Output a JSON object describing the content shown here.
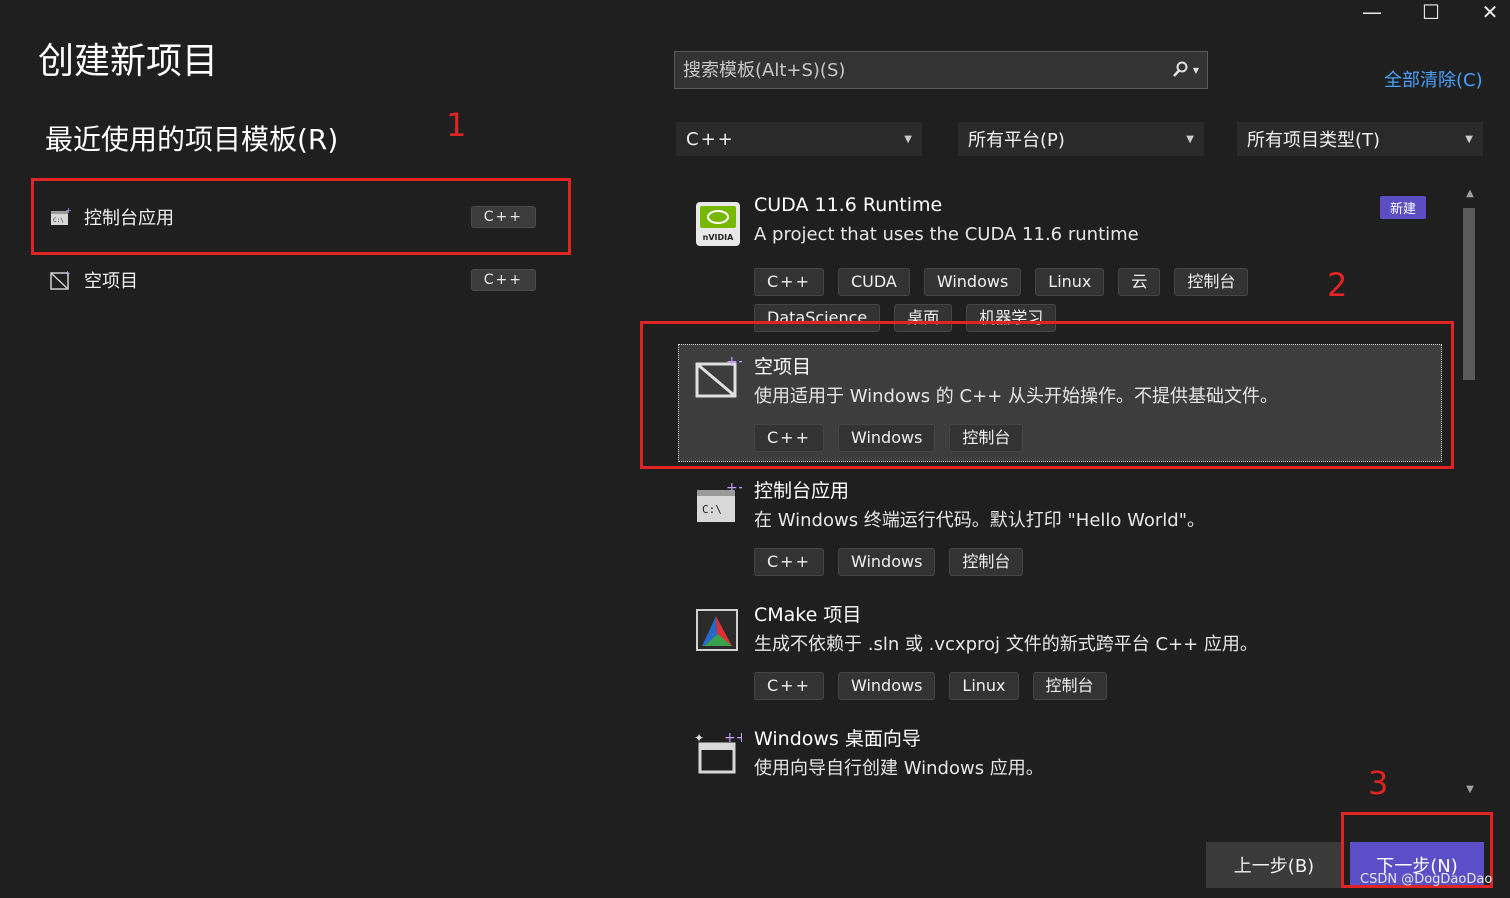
{
  "window": {
    "minimize_glyph": "—",
    "maximize_glyph": "☐",
    "close_glyph": "✕"
  },
  "page_title": "创建新项目",
  "recent": {
    "title": "最近使用的项目模板(R)",
    "items": [
      {
        "label": "控制台应用",
        "tag": "C++"
      },
      {
        "label": "空项目",
        "tag": "C++"
      }
    ]
  },
  "search": {
    "placeholder": "搜索模板(Alt+S)(S)",
    "clear_all": "全部清除(C)"
  },
  "filters": {
    "language": "C++",
    "platform": "所有平台(P)",
    "project_type": "所有项目类型(T)"
  },
  "templates": [
    {
      "name": "CUDA 11.6 Runtime",
      "desc": "A project that uses the CUDA 11.6 runtime",
      "badge": "新建",
      "tags": [
        "C++",
        "CUDA",
        "Windows",
        "Linux",
        "云",
        "控制台",
        "DataScience",
        "桌面",
        "机器学习"
      ]
    },
    {
      "name": "空项目",
      "desc": "使用适用于 Windows 的 C++ 从头开始操作。不提供基础文件。",
      "tags": [
        "C++",
        "Windows",
        "控制台"
      ]
    },
    {
      "name": "控制台应用",
      "desc": "在 Windows 终端运行代码。默认打印 \"Hello World\"。",
      "tags": [
        "C++",
        "Windows",
        "控制台"
      ]
    },
    {
      "name": "CMake 项目",
      "desc": "生成不依赖于 .sln 或 .vcxproj 文件的新式跨平台 C++ 应用。",
      "tags": [
        "C++",
        "Windows",
        "Linux",
        "控制台"
      ]
    },
    {
      "name": "Windows 桌面向导",
      "desc": "使用向导自行创建 Windows 应用。",
      "tags": []
    }
  ],
  "icons": {
    "nvidia_label": "nVIDIA",
    "console_label": "C:\\"
  },
  "buttons": {
    "back": "上一步(B)",
    "next": "下一步(N)"
  },
  "annotations": [
    "1",
    "2",
    "3"
  ],
  "watermark": "CSDN @DogDaoDao",
  "colors": {
    "background": "#1f1f1f",
    "accent": "#5a4fc6",
    "link": "#4aa0ff",
    "annotation": "#e02424"
  }
}
